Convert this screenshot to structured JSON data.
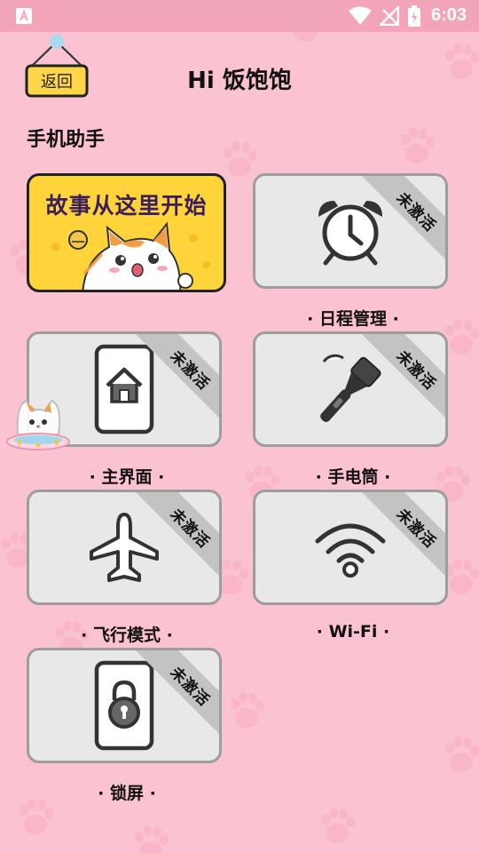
{
  "status_bar": {
    "time": "6:03"
  },
  "header": {
    "back_label": "返回",
    "title": "Hi 饭饱饱"
  },
  "section_title": "手机助手",
  "banner": {
    "text": "故事从这里开始"
  },
  "cards": [
    {
      "label": "· 日程管理 ·",
      "badge": "未激活",
      "icon": "alarm-clock-icon"
    },
    {
      "label": "· 主界面 ·",
      "badge": "未激活",
      "icon": "home-phone-icon"
    },
    {
      "label": "· 手电筒 ·",
      "badge": "未激活",
      "icon": "flashlight-icon"
    },
    {
      "label": "· 飞行模式 ·",
      "badge": "未激活",
      "icon": "airplane-icon"
    },
    {
      "label": "· Wi-Fi ·",
      "badge": "未激活",
      "icon": "wifi-icon"
    },
    {
      "label": "· 锁屏 ·",
      "badge": "未激活",
      "icon": "lock-phone-icon"
    }
  ],
  "colors": {
    "background": "#fbc2d1",
    "status_bar": "#f2a5b8",
    "banner": "#ffd33a",
    "card": "#e8e8e8"
  }
}
